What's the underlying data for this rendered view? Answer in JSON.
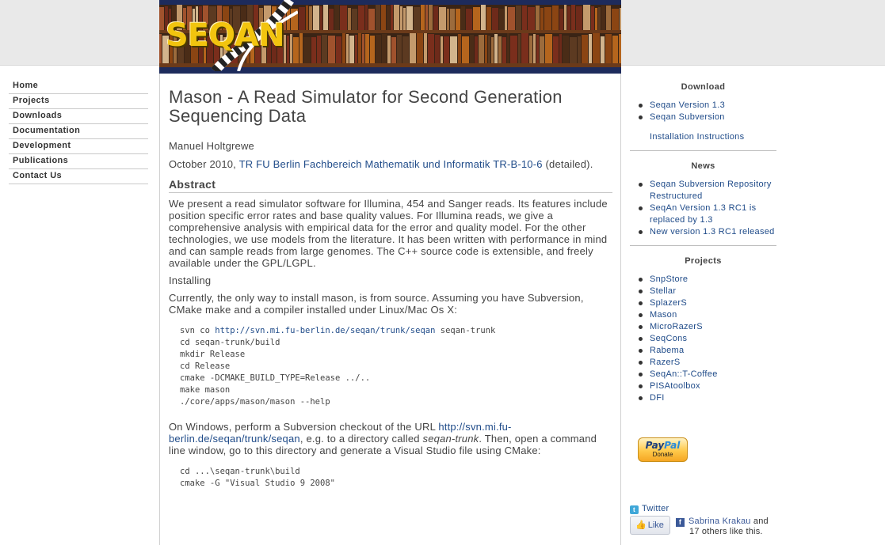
{
  "logo": {
    "text": "SEQAN"
  },
  "nav": {
    "items": [
      {
        "label": "Home"
      },
      {
        "label": "Projects"
      },
      {
        "label": "Downloads"
      },
      {
        "label": "Documentation"
      },
      {
        "label": "Development"
      },
      {
        "label": "Publications"
      },
      {
        "label": "Contact Us"
      }
    ]
  },
  "article": {
    "title": "Mason - A Read Simulator for Second Generation Sequencing Data",
    "author": "Manuel Holtgrewe",
    "date": "October 2010, ",
    "report_link": "TR FU Berlin Fachbereich Mathematik und Informatik TR-B-10-6",
    "detailed": " (detailed).",
    "abstract_heading": "Abstract",
    "abstract": "We present a read simulator software for Illumina, 454 and Sanger reads. Its features include position specific error rates and base quality values. For Illumina reads, we give a comprehensive analysis with empirical data for the error and quality model. For the other technologies, we use models from the literature. It has been written with performance in mind and can sample reads from large genomes. The C++ source code is extensible, and freely available under the GPL/LGPL.",
    "installing_heading": "Installing",
    "install_intro": "Currently, the only way to install mason, is from source. Assuming you have Subversion, CMake make and a compiler installed under Linux/Mac Os X:",
    "code1": {
      "svn_prefix": "svn co ",
      "svn_url": "http://svn.mi.fu-berlin.de/seqan/trunk/seqan",
      "svn_suffix": " seqan-trunk",
      "lines": [
        "cd seqan-trunk/build",
        "mkdir Release",
        "cd Release",
        "cmake -DCMAKE_BUILD_TYPE=Release ../..",
        "make mason",
        "./core/apps/mason/mason --help"
      ]
    },
    "windows_p1": "On Windows, perform a Subversion checkout of the URL ",
    "windows_link": "http://svn.mi.fu-berlin.de/seqan/trunk/seqan",
    "windows_p2": ", e.g. to a directory called ",
    "windows_em": "seqan-trunk",
    "windows_p3": ". Then, open a command line window, go to this directory and generate a Visual Studio file using CMake:",
    "code2": {
      "lines": [
        "cd ...\\seqan-trunk\\build",
        "cmake -G \"Visual Studio 9 2008\""
      ]
    }
  },
  "sidebar": {
    "download": {
      "heading": "Download",
      "items": [
        "Seqan Version 1.3",
        "Seqan Subversion"
      ],
      "extra": "Installation Instructions"
    },
    "news": {
      "heading": "News",
      "items": [
        "Seqan Subversion Repository Restructured",
        "SeqAn Version 1.3 RC1 is replaced by 1.3",
        "New version 1.3 RC1 released"
      ]
    },
    "projects": {
      "heading": "Projects",
      "items": [
        "SnpStore",
        "Stellar",
        "SplazerS",
        "Mason",
        "MicroRazerS",
        "SeqCons",
        "Rabema",
        "RazerS",
        "SeqAn::T-Coffee",
        "PISAtoolbox",
        "DFI"
      ]
    }
  },
  "paypal": {
    "logo_a": "Pay",
    "logo_b": "Pal",
    "label": "Donate"
  },
  "social": {
    "twitter": "Twitter",
    "like": "Like",
    "fb_name": "Sabrina Krakau",
    "fb_and": " and",
    "fb_rest": "17 others like this."
  }
}
